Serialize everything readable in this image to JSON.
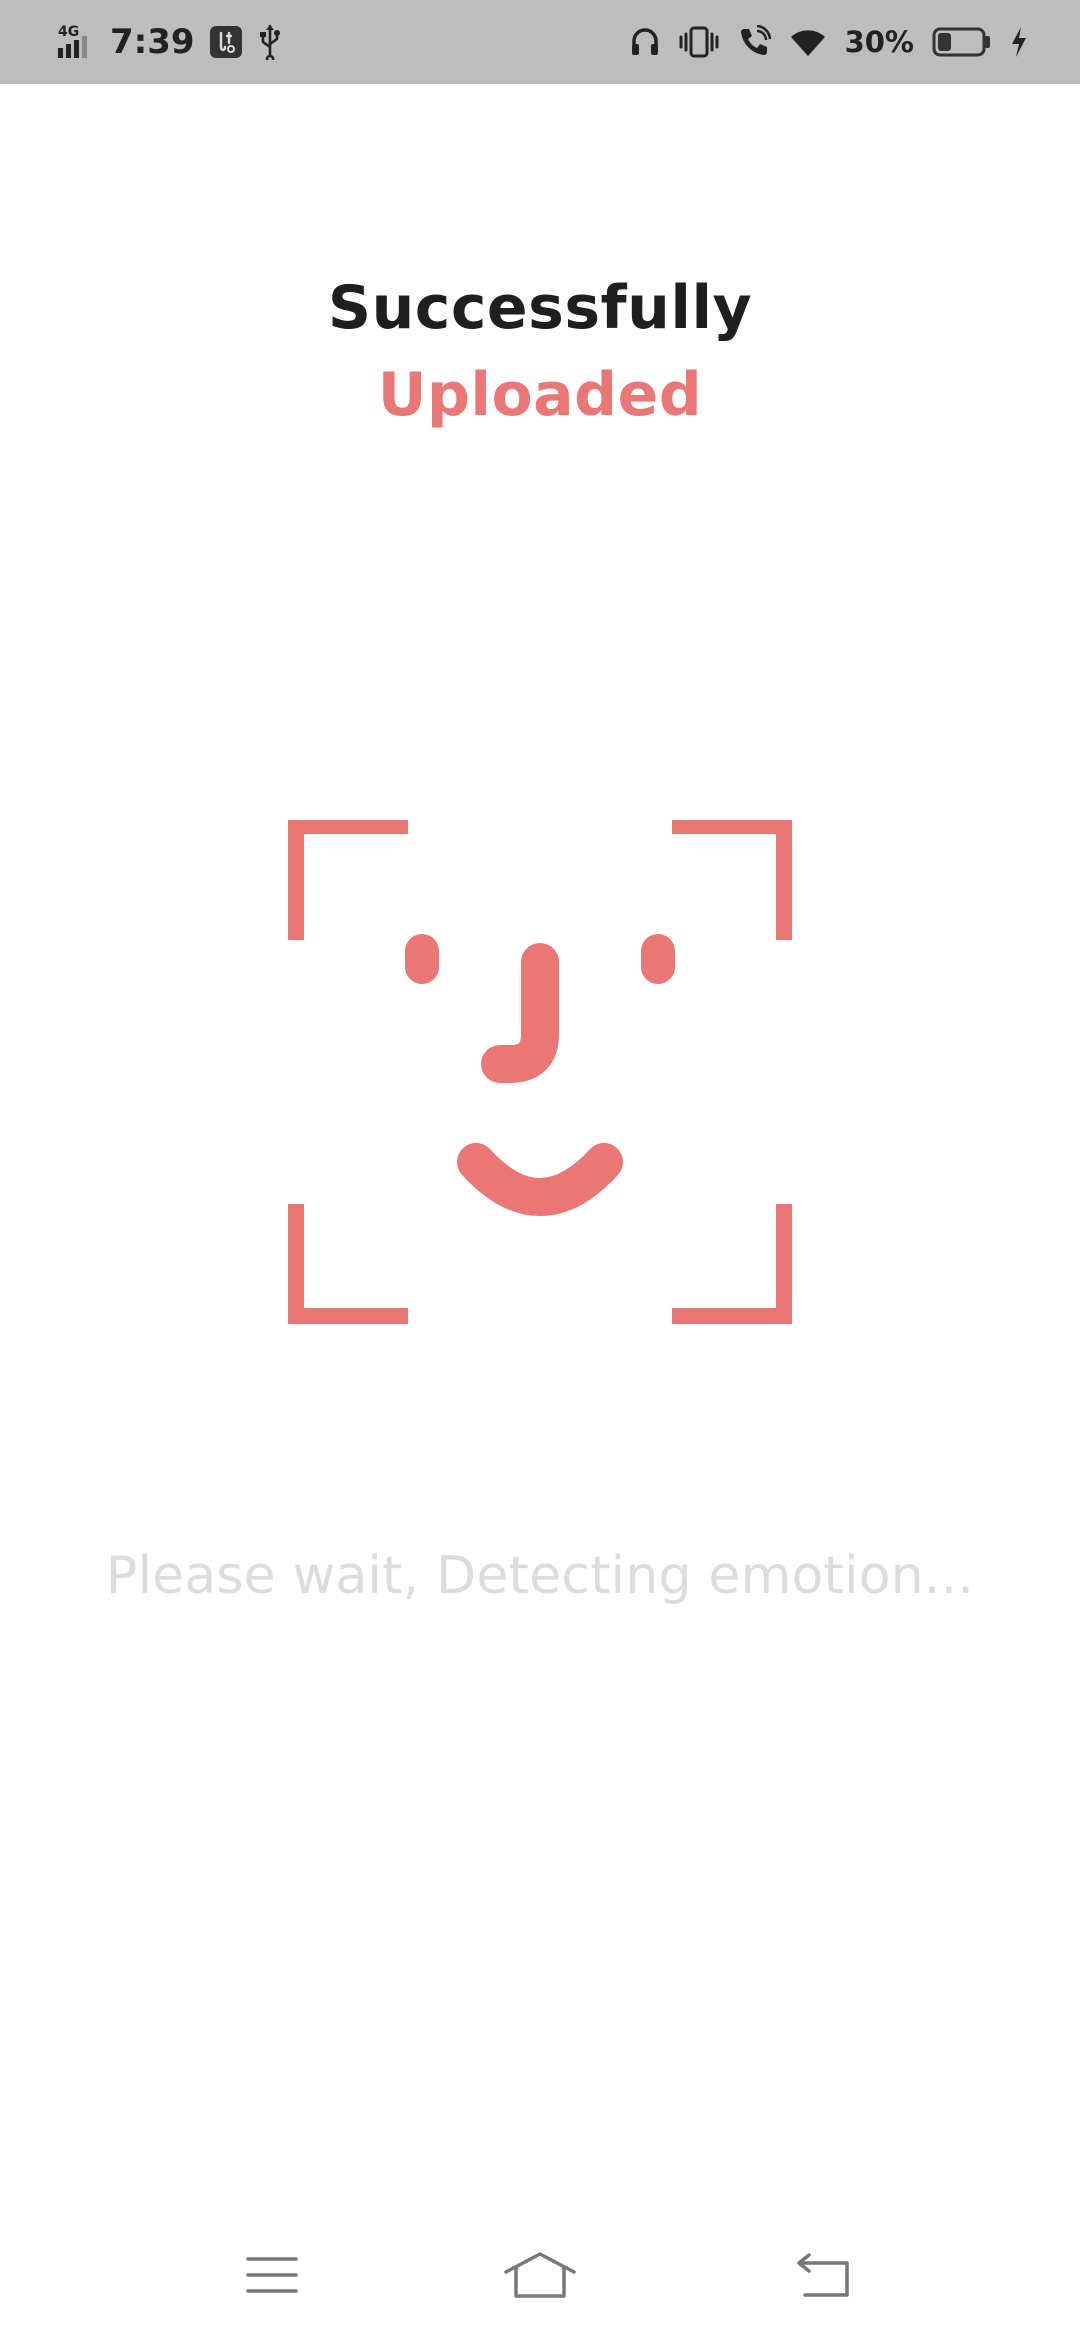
{
  "status_bar": {
    "network": "4G",
    "time": "7:39",
    "battery_percent": "30%",
    "battery_level": 0.3,
    "icons": [
      "signal-icon",
      "usb-debug-icon",
      "usb-icon",
      "headphones-icon",
      "vibrate-icon",
      "wifi-call-icon",
      "wifi-icon",
      "battery-icon",
      "charging-icon"
    ]
  },
  "header": {
    "line1": "Successfully",
    "line2": "Uploaded"
  },
  "illustration": {
    "icon": "face-scan-icon",
    "color": "#ea7676"
  },
  "message": "Please wait, Detecting emotion...",
  "nav": {
    "icons": [
      "menu-icon",
      "home-icon",
      "back-icon"
    ]
  },
  "colors": {
    "accent": "#ea7676",
    "title": "#1f1f1f",
    "muted": "#dcdcdc",
    "status_bar_bg": "#bdbdbd"
  }
}
